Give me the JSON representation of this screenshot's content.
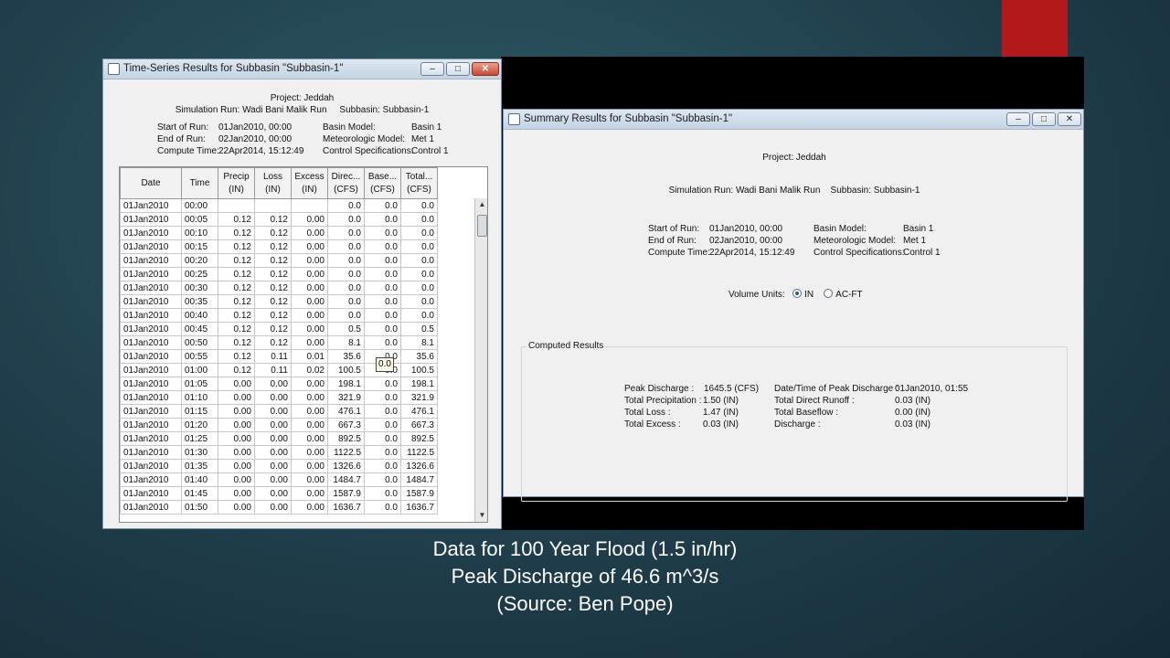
{
  "ts_window": {
    "title": "Time-Series Results for Subbasin \"Subbasin-1\"",
    "project_line": "Project: Jeddah",
    "run_line": "Simulation Run: Wadi Bani Malik Run",
    "subbasin_line": "Subbasin: Subbasin-1",
    "meta": {
      "start_label": "Start of Run:",
      "start_value": "01Jan2010, 00:00",
      "end_label": "End of Run:",
      "end_value": "02Jan2010, 00:00",
      "compute_label": "Compute Time:",
      "compute_value": "22Apr2014, 15:12:49",
      "basin_label": "Basin Model:",
      "basin_value": "Basin 1",
      "met_label": "Meteorologic Model:",
      "met_value": "Met 1",
      "control_label": "Control Specifications:",
      "control_value": "Control 1"
    },
    "columns": [
      {
        "top": "Date",
        "bottom": ""
      },
      {
        "top": "Time",
        "bottom": ""
      },
      {
        "top": "Precip",
        "bottom": "(IN)"
      },
      {
        "top": "Loss",
        "bottom": "(IN)"
      },
      {
        "top": "Excess",
        "bottom": "(IN)"
      },
      {
        "top": "Direc...",
        "bottom": "(CFS)"
      },
      {
        "top": "Base...",
        "bottom": "(CFS)"
      },
      {
        "top": "Total...",
        "bottom": "(CFS)"
      }
    ],
    "rows": [
      [
        "01Jan2010",
        "00:00",
        "",
        "",
        "",
        "0.0",
        "0.0",
        "0.0"
      ],
      [
        "01Jan2010",
        "00:05",
        "0.12",
        "0.12",
        "0.00",
        "0.0",
        "0.0",
        "0.0"
      ],
      [
        "01Jan2010",
        "00:10",
        "0.12",
        "0.12",
        "0.00",
        "0.0",
        "0.0",
        "0.0"
      ],
      [
        "01Jan2010",
        "00:15",
        "0.12",
        "0.12",
        "0.00",
        "0.0",
        "0.0",
        "0.0"
      ],
      [
        "01Jan2010",
        "00:20",
        "0.12",
        "0.12",
        "0.00",
        "0.0",
        "0.0",
        "0.0"
      ],
      [
        "01Jan2010",
        "00:25",
        "0.12",
        "0.12",
        "0.00",
        "0.0",
        "0.0",
        "0.0"
      ],
      [
        "01Jan2010",
        "00:30",
        "0.12",
        "0.12",
        "0.00",
        "0.0",
        "0.0",
        "0.0"
      ],
      [
        "01Jan2010",
        "00:35",
        "0.12",
        "0.12",
        "0.00",
        "0.0",
        "0.0",
        "0.0"
      ],
      [
        "01Jan2010",
        "00:40",
        "0.12",
        "0.12",
        "0.00",
        "0.0",
        "0.0",
        "0.0"
      ],
      [
        "01Jan2010",
        "00:45",
        "0.12",
        "0.12",
        "0.00",
        "0.5",
        "0.0",
        "0.5"
      ],
      [
        "01Jan2010",
        "00:50",
        "0.12",
        "0.12",
        "0.00",
        "8.1",
        "0.0",
        "8.1"
      ],
      [
        "01Jan2010",
        "00:55",
        "0.12",
        "0.11",
        "0.01",
        "35.6",
        "0.0",
        "35.6"
      ],
      [
        "01Jan2010",
        "01:00",
        "0.12",
        "0.11",
        "0.02",
        "100.5",
        "0.0",
        "100.5"
      ],
      [
        "01Jan2010",
        "01:05",
        "0.00",
        "0.00",
        "0.00",
        "198.1",
        "0.0",
        "198.1"
      ],
      [
        "01Jan2010",
        "01:10",
        "0.00",
        "0.00",
        "0.00",
        "321.9",
        "0.0",
        "321.9"
      ],
      [
        "01Jan2010",
        "01:15",
        "0.00",
        "0.00",
        "0.00",
        "476.1",
        "0.0",
        "476.1"
      ],
      [
        "01Jan2010",
        "01:20",
        "0.00",
        "0.00",
        "0.00",
        "667.3",
        "0.0",
        "667.3"
      ],
      [
        "01Jan2010",
        "01:25",
        "0.00",
        "0.00",
        "0.00",
        "892.5",
        "0.0",
        "892.5"
      ],
      [
        "01Jan2010",
        "01:30",
        "0.00",
        "0.00",
        "0.00",
        "1122.5",
        "0.0",
        "1122.5"
      ],
      [
        "01Jan2010",
        "01:35",
        "0.00",
        "0.00",
        "0.00",
        "1326.6",
        "0.0",
        "1326.6"
      ],
      [
        "01Jan2010",
        "01:40",
        "0.00",
        "0.00",
        "0.00",
        "1484.7",
        "0.0",
        "1484.7"
      ],
      [
        "01Jan2010",
        "01:45",
        "0.00",
        "0.00",
        "0.00",
        "1587.9",
        "0.0",
        "1587.9"
      ],
      [
        "01Jan2010",
        "01:50",
        "0.00",
        "0.00",
        "0.00",
        "1636.7",
        "0.0",
        "1636.7"
      ]
    ],
    "tooltip": "0.0"
  },
  "sum_window": {
    "title": "Summary Results for Subbasin \"Subbasin-1\"",
    "project_line": "Project: Jeddah",
    "run_line": "Simulation Run: Wadi Bani Malik Run",
    "subbasin_line": "Subbasin: Subbasin-1",
    "meta": {
      "start_label": "Start of Run:",
      "start_value": "01Jan2010, 00:00",
      "end_label": "End of Run:",
      "end_value": "02Jan2010, 00:00",
      "compute_label": "Compute Time:",
      "compute_value": "22Apr2014, 15:12:49",
      "basin_label": "Basin Model:",
      "basin_value": "Basin 1",
      "met_label": "Meteorologic Model:",
      "met_value": "Met 1",
      "control_label": "Control Specifications:",
      "control_value": "Control 1"
    },
    "volume_units_label": "Volume Units:",
    "unit_in": "IN",
    "unit_acft": "AC-FT",
    "computed_results_label": "Computed Results",
    "results": {
      "peak_discharge_label": "Peak Discharge :",
      "peak_discharge_value": "1645.5 (CFS)",
      "total_precip_label": "Total Precipitation :",
      "total_precip_value": "1.50 (IN)",
      "total_loss_label": "Total Loss :",
      "total_loss_value": "1.47 (IN)",
      "total_excess_label": "Total Excess :",
      "total_excess_value": "0.03 (IN)",
      "peak_time_label": "Date/Time of Peak Discharge :",
      "peak_time_value": "01Jan2010, 01:55",
      "direct_runoff_label": "Total Direct Runoff :",
      "direct_runoff_value": "0.03 (IN)",
      "baseflow_label": "Total Baseflow :",
      "baseflow_value": "0.00 (IN)",
      "discharge_label": "Discharge :",
      "discharge_value": "0.03 (IN)"
    }
  },
  "window_buttons": {
    "minimize": "–",
    "maximize": "□",
    "close": "✕"
  },
  "caption": {
    "line1": "Data for 100 Year Flood (1.5 in/hr)",
    "line2": "Peak Discharge of 46.6 m^3/s",
    "line3": "(Source: Ben Pope)"
  }
}
